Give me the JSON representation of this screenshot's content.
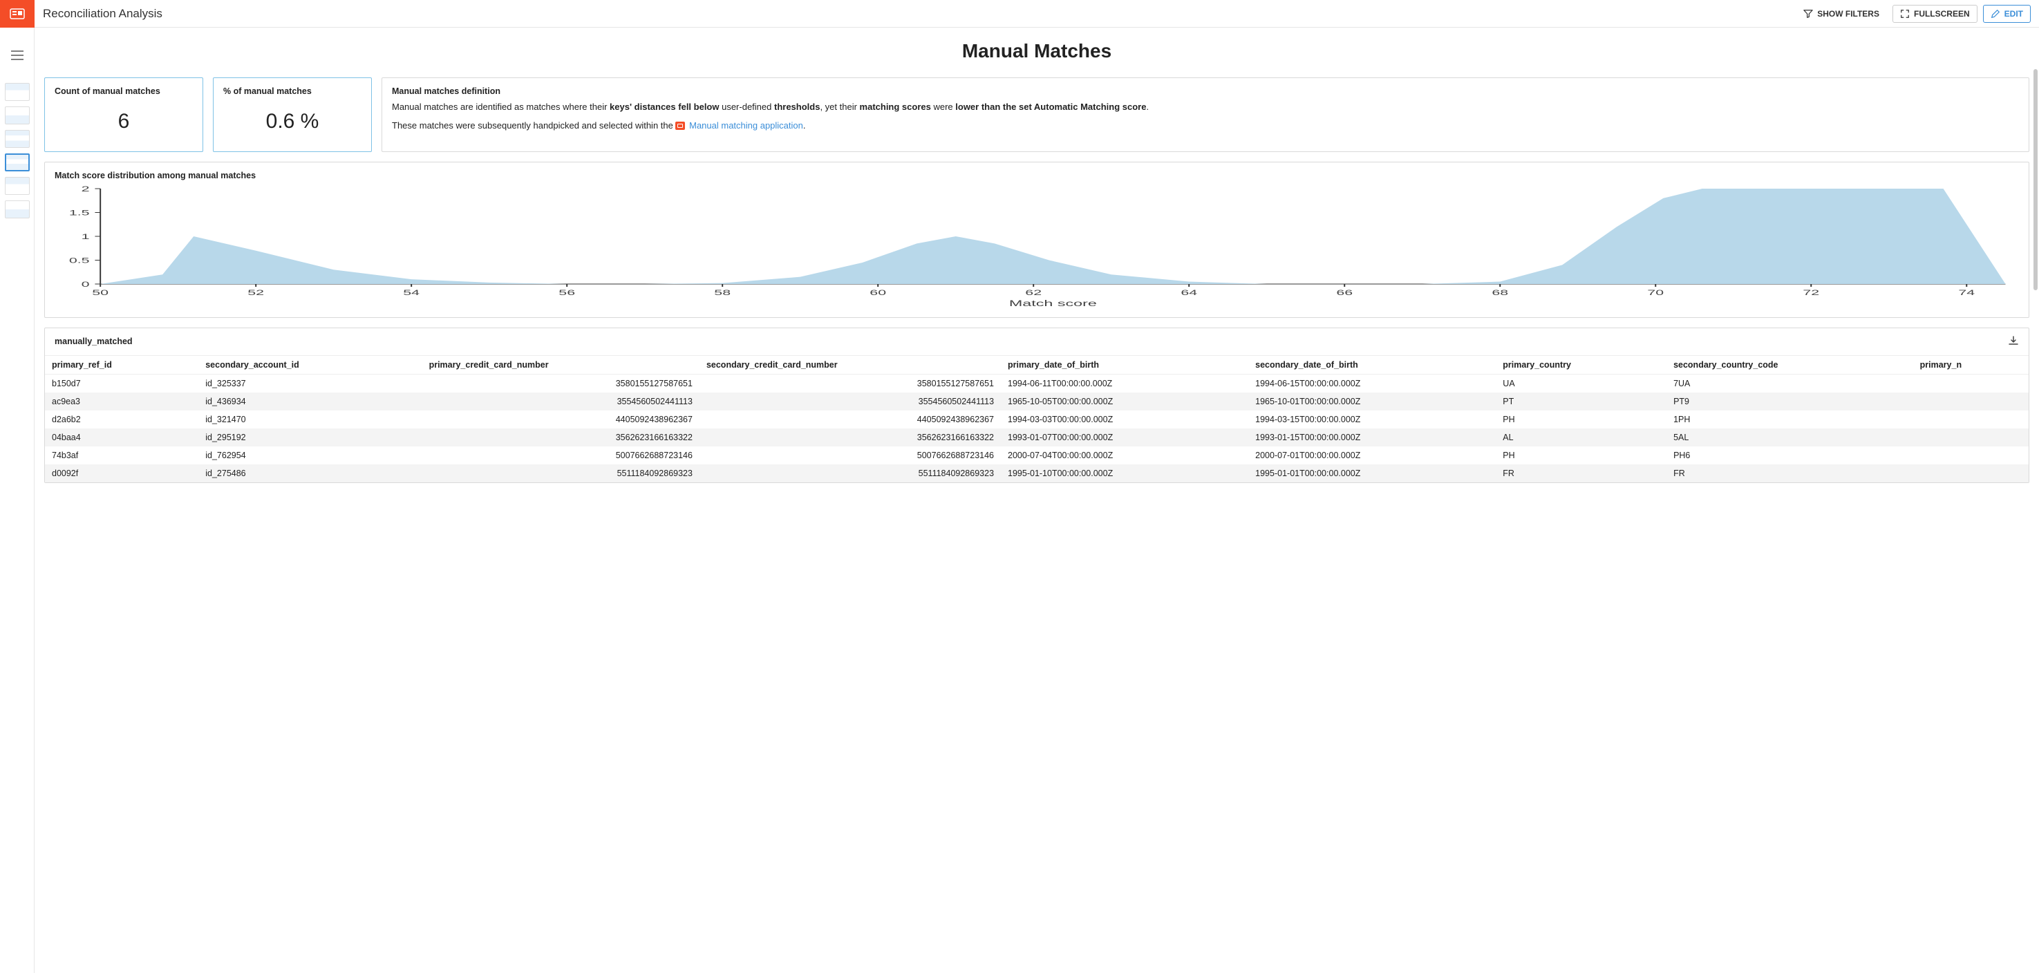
{
  "topbar": {
    "title": "Reconciliation Analysis",
    "show_filters": "SHOW FILTERS",
    "fullscreen": "FULLSCREEN",
    "edit": "EDIT"
  },
  "page_title": "Manual Matches",
  "kpi_count": {
    "label": "Count of manual matches",
    "value": "6"
  },
  "kpi_pct": {
    "label": "% of manual matches",
    "value": "0.6 %"
  },
  "definition": {
    "title": "Manual matches definition",
    "line1_a": "Manual matches are identified as matches where their ",
    "line1_b": "keys' distances fell below",
    "line1_c": " user-defined ",
    "line1_d": "thresholds",
    "line1_e": ", yet their ",
    "line1_f": "matching scores",
    "line1_g": " were ",
    "line1_h": "lower than the set Automatic Matching score",
    "line1_i": ".",
    "line2_a": "These matches were subsequently handpicked and selected within the ",
    "link": "Manual matching application",
    "line2_b": "."
  },
  "chart_title": "Match score distribution among manual matches",
  "chart_xlabel": "Match score",
  "chart_data": {
    "type": "area",
    "xlabel": "Match score",
    "ylabel": "",
    "xlim": [
      50,
      74.5
    ],
    "ylim": [
      0,
      2
    ],
    "x_ticks": [
      50,
      52,
      54,
      56,
      58,
      60,
      62,
      64,
      66,
      68,
      70,
      72,
      74
    ],
    "y_ticks": [
      0,
      0.5,
      1,
      1.5,
      2
    ],
    "series": [
      {
        "name": "density",
        "x": [
          50,
          50.8,
          51.2,
          52,
          53,
          54,
          55,
          56,
          57,
          58,
          59,
          59.8,
          60.5,
          61,
          61.5,
          62.2,
          63,
          64,
          65,
          66,
          67,
          68,
          68.8,
          69.5,
          70.1,
          70.6,
          73.7,
          74.5
        ],
        "values": [
          0,
          0.2,
          1,
          0.7,
          0.3,
          0.1,
          0.03,
          0,
          0,
          0.02,
          0.15,
          0.45,
          0.85,
          1,
          0.85,
          0.5,
          0.2,
          0.05,
          0,
          0,
          0,
          0.05,
          0.4,
          1.2,
          1.8,
          2,
          2,
          0
        ]
      }
    ]
  },
  "table": {
    "title": "manually_matched",
    "columns": [
      "primary_ref_id",
      "secondary_account_id",
      "primary_credit_card_number",
      "secondary_credit_card_number",
      "primary_date_of_birth",
      "secondary_date_of_birth",
      "primary_country",
      "secondary_country_code",
      "primary_n"
    ],
    "numeric_cols": [
      2,
      3
    ],
    "rows": [
      [
        "b150d7",
        "id_325337",
        "3580155127587651",
        "3580155127587651",
        "1994-06-11T00:00:00.000Z",
        "1994-06-15T00:00:00.000Z",
        "UA",
        "7UA",
        ""
      ],
      [
        "ac9ea3",
        "id_436934",
        "3554560502441113",
        "3554560502441113",
        "1965-10-05T00:00:00.000Z",
        "1965-10-01T00:00:00.000Z",
        "PT",
        "PT9",
        ""
      ],
      [
        "d2a6b2",
        "id_321470",
        "4405092438962367",
        "4405092438962367",
        "1994-03-03T00:00:00.000Z",
        "1994-03-15T00:00:00.000Z",
        "PH",
        "1PH",
        ""
      ],
      [
        "04baa4",
        "id_295192",
        "3562623166163322",
        "3562623166163322",
        "1993-01-07T00:00:00.000Z",
        "1993-01-15T00:00:00.000Z",
        "AL",
        "5AL",
        ""
      ],
      [
        "74b3af",
        "id_762954",
        "5007662688723146",
        "5007662688723146",
        "2000-07-04T00:00:00.000Z",
        "2000-07-01T00:00:00.000Z",
        "PH",
        "PH6",
        ""
      ],
      [
        "d0092f",
        "id_275486",
        "5511184092869323",
        "5511184092869323",
        "1995-01-10T00:00:00.000Z",
        "1995-01-01T00:00:00.000Z",
        "FR",
        "FR",
        ""
      ]
    ]
  }
}
